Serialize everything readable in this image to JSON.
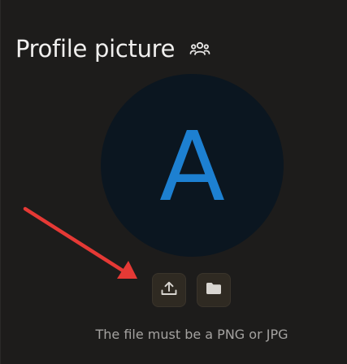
{
  "section": {
    "title": "Profile picture",
    "title_icon": "people-group-icon"
  },
  "avatar": {
    "initial": "A",
    "background_color": "#0b1620",
    "letter_color": "#1d80d1"
  },
  "actions": {
    "upload_icon": "upload-icon",
    "folder_icon": "folder-icon"
  },
  "hint": {
    "text": "The file must be a PNG or JPG"
  },
  "annotation": {
    "type": "red-arrow",
    "color": "#e53935",
    "points_to": "upload-button"
  }
}
